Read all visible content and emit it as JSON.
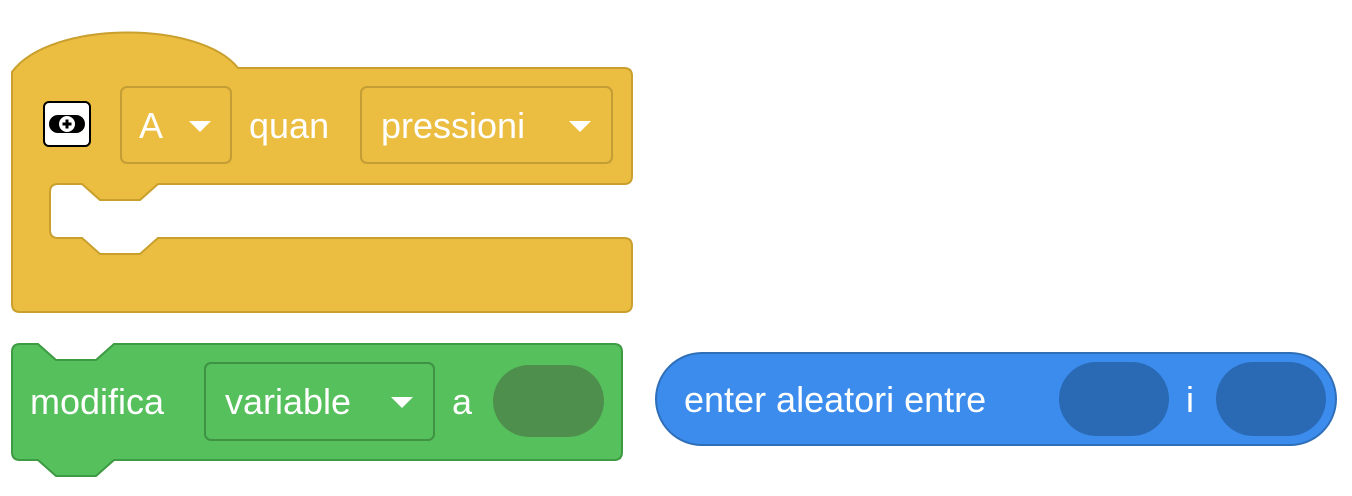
{
  "hat_block": {
    "button_dropdown": {
      "value": "A"
    },
    "connector_word": "quan",
    "action_dropdown": {
      "value": "pressioni"
    },
    "icon": "controller-icon",
    "color": "#ebbd40",
    "border_color": "#c99f2e"
  },
  "variable_block": {
    "label": "modifica",
    "variable_dropdown": {
      "value": "variable"
    },
    "connector_word": "a",
    "color": "#56c15c",
    "border_color": "#3e9a43",
    "slot_color": "#4f8f4d"
  },
  "random_block": {
    "label": "enter aleatori entre",
    "connector_word": "i",
    "color": "#3b8ced",
    "border_color": "#2f6fb8",
    "slot_color": "#2a6ab5"
  }
}
